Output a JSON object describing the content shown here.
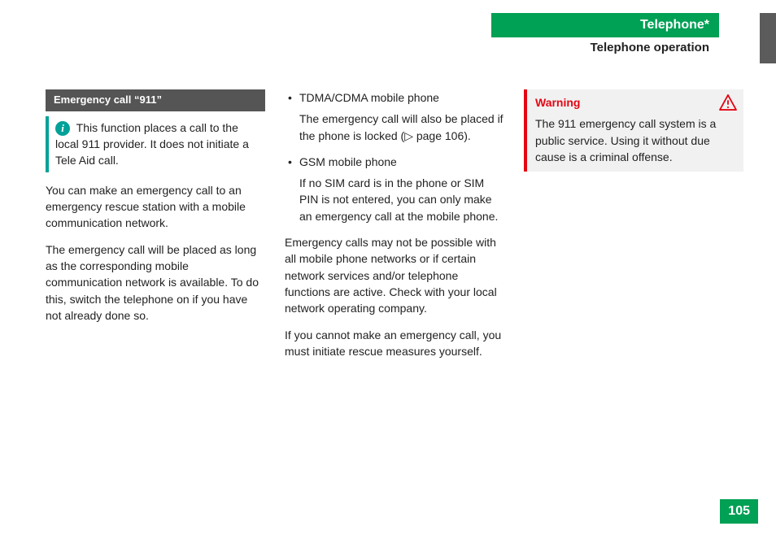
{
  "header": {
    "chapter": "Telephone*",
    "section": "Telephone operation"
  },
  "col1": {
    "heading": "Emergency call “911”",
    "info": "This function places a call to the local 911 provider. It does not initiate a Tele Aid call.",
    "p1": "You can make an emergency call to an emergency rescue station with a mobile communication network.",
    "p2": "The emergency call will be placed as long as the corresponding mobile communication network is available. To do this, switch the telephone on if you have not already done so."
  },
  "col2": {
    "b1_head": "TDMA/CDMA mobile phone",
    "b1_body_a": "The emergency call will also be placed if the phone is locked (",
    "b1_body_ref": "▷ page 106",
    "b1_body_b": ").",
    "b2_head": "GSM mobile phone",
    "b2_body": "If no SIM card is in the phone or SIM PIN is not entered, you can only make an emergency call at the mobile phone.",
    "p1": "Emergency calls may not be possible with all mobile phone networks or if certain network services and/or telephone functions are active. Check with your local network operating company.",
    "p2": "If you cannot make an emergency call, you must initiate rescue measures yourself."
  },
  "col3": {
    "warning_title": "Warning",
    "warning_body": "The 911 emergency call system is a public service. Using it without due cause is a criminal offense."
  },
  "page_number": "105"
}
